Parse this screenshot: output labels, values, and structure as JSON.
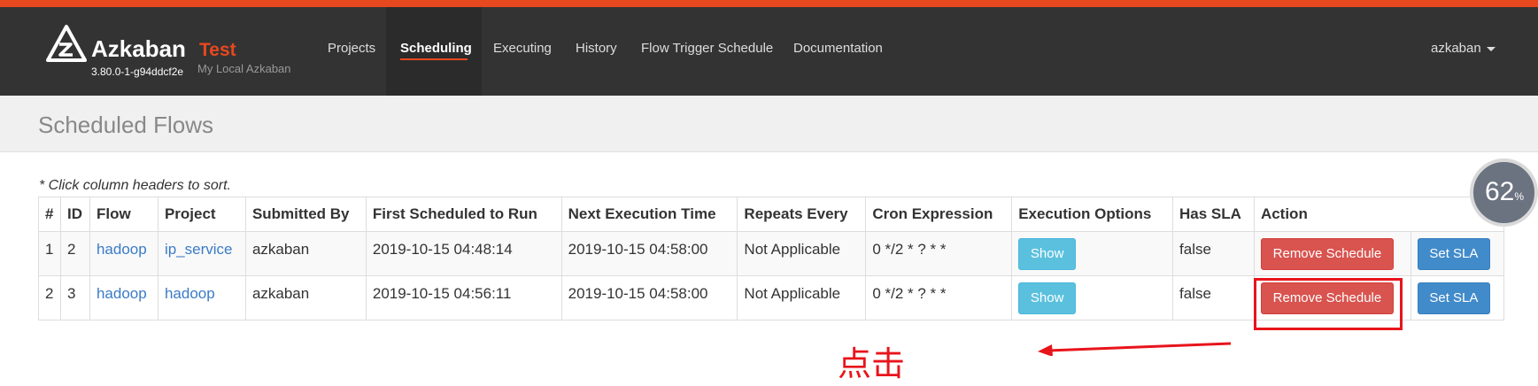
{
  "app": {
    "name": "Azkaban",
    "env": "Test",
    "version": "3.80.0-1-g94ddcf2e",
    "subtitle": "My Local Azkaban"
  },
  "nav": {
    "items": [
      {
        "label": "Projects"
      },
      {
        "label": "Scheduling"
      },
      {
        "label": "Executing"
      },
      {
        "label": "History"
      },
      {
        "label": "Flow Trigger Schedule"
      },
      {
        "label": "Documentation"
      }
    ],
    "active": "Scheduling",
    "user": "azkaban"
  },
  "page": {
    "title": "Scheduled Flows",
    "sort_note": "* Click column headers to sort."
  },
  "table": {
    "headers": [
      "#",
      "ID",
      "Flow",
      "Project",
      "Submitted By",
      "First Scheduled to Run",
      "Next Execution Time",
      "Repeats Every",
      "Cron Expression",
      "Execution Options",
      "Has SLA",
      "Action"
    ],
    "rows": [
      {
        "num": "1",
        "id": "2",
        "flow": "hadoop",
        "project": "ip_service",
        "submitted_by": "azkaban",
        "first_run": "2019-10-15 04:48:14",
        "next_run": "2019-10-15 04:58:00",
        "repeats": "Not Applicable",
        "cron": "0 */2 * ? * *",
        "options_btn": "Show",
        "has_sla": "false",
        "remove_btn": "Remove Schedule",
        "sla_btn": "Set SLA"
      },
      {
        "num": "2",
        "id": "3",
        "flow": "hadoop",
        "project": "hadoop",
        "submitted_by": "azkaban",
        "first_run": "2019-10-15 04:56:11",
        "next_run": "2019-10-15 04:58:00",
        "repeats": "Not Applicable",
        "cron": "0 */2 * ? * *",
        "options_btn": "Show",
        "has_sla": "false",
        "remove_btn": "Remove Schedule",
        "sla_btn": "Set SLA"
      }
    ]
  },
  "annotation": {
    "text": "点击"
  },
  "gauge": {
    "value": "62",
    "unit": "%"
  },
  "colors": {
    "accent": "#e8481f",
    "navbar": "#333333",
    "link": "#3a7bc8",
    "annotation": "#e8141b"
  }
}
